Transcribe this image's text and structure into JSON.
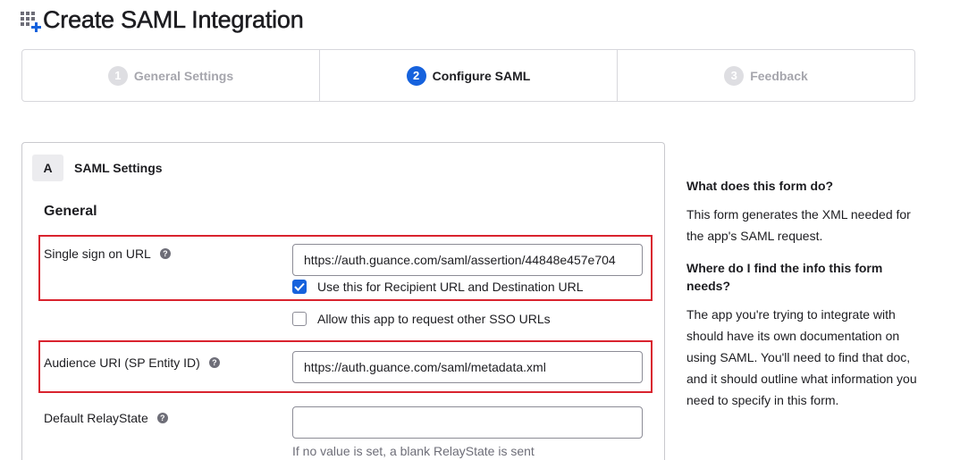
{
  "header": {
    "title": "Create SAML Integration",
    "icon": "app-grid-plus-icon"
  },
  "steps": [
    {
      "number": "1",
      "label": "General Settings",
      "state": "inactive"
    },
    {
      "number": "2",
      "label": "Configure SAML",
      "state": "active"
    },
    {
      "number": "3",
      "label": "Feedback",
      "state": "inactive"
    }
  ],
  "section": {
    "letter": "A",
    "title": "SAML Settings",
    "subtitle": "General"
  },
  "fields": {
    "sso_url": {
      "label": "Single sign on URL",
      "value": "https://auth.guance.com/saml/assertion/44848e457e704"
    },
    "recipient_checkbox": {
      "label": "Use this for Recipient URL and Destination URL",
      "checked": true
    },
    "other_sso_checkbox": {
      "label": "Allow this app to request other SSO URLs",
      "checked": false
    },
    "audience_uri": {
      "label": "Audience URI (SP Entity ID)",
      "value": "https://auth.guance.com/saml/metadata.xml"
    },
    "relay_state": {
      "label": "Default RelayState",
      "value": "",
      "hint": "If no value is set, a blank RelayState is sent"
    }
  },
  "help_glyph": "?",
  "sidebar": {
    "q1": "What does this form do?",
    "a1": "This form generates the XML needed for the app's SAML request.",
    "q2": "Where do I find the info this form needs?",
    "a2": "The app you're trying to integrate with should have its own documentation on using SAML. You'll need to find that doc, and it should outline what information you need to specify in this form."
  },
  "colors": {
    "accent": "#1662dd",
    "highlight": "#d9232e",
    "muted": "#a6a6ad"
  }
}
